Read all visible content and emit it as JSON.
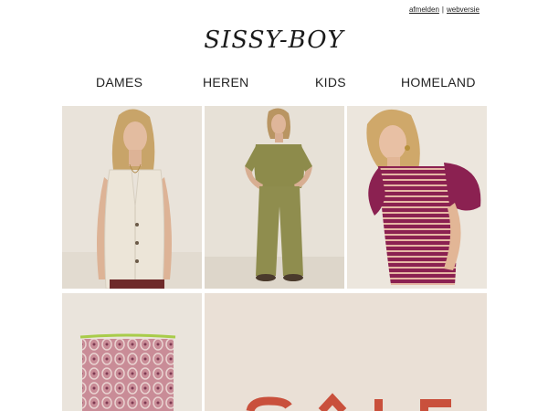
{
  "header": {
    "links": {
      "unsubscribe": "afmelden",
      "separator": "|",
      "web_version": "webversie"
    },
    "logo": "SISSY-BOY"
  },
  "nav": {
    "items": [
      {
        "label": "DAMES"
      },
      {
        "label": "HEREN"
      },
      {
        "label": "KIDS"
      },
      {
        "label": "HOMELAND"
      }
    ]
  },
  "products": [
    {
      "name": "woman-in-cream-waistcoat"
    },
    {
      "name": "woman-in-olive-two-piece"
    },
    {
      "name": "woman-in-striped-knit-top"
    },
    {
      "name": "patterned-cushion"
    },
    {
      "name": "sale-banner"
    }
  ],
  "colors": {
    "background": "#ffffff",
    "photo_backdrop": "#e8e2d8",
    "sale_backdrop": "#eae0d6",
    "sale_text": "#c9503c",
    "olive": "#8a8a4a",
    "berry": "#8b2151"
  }
}
